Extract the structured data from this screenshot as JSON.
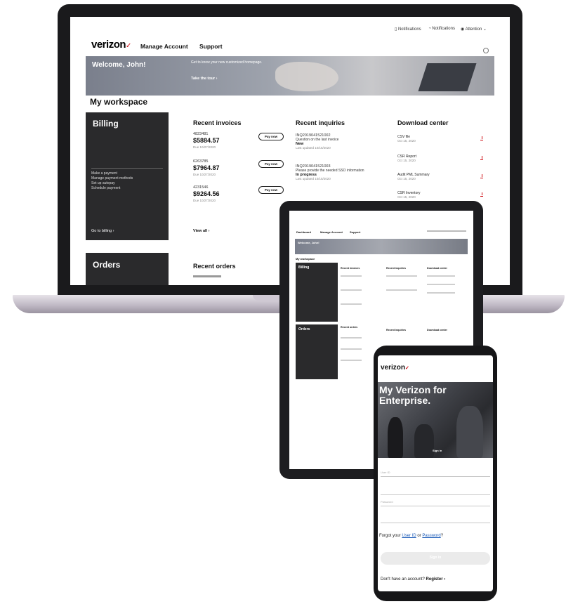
{
  "laptop": {
    "topbar": {
      "item1": "Notifications",
      "item2": "Notifications",
      "item3": "Attention"
    },
    "logo": "verizon",
    "nav": [
      "Manage Account",
      "Support"
    ],
    "hero": {
      "welcome": "Welcome, John!",
      "promo": "Get to know your new customized homepage.",
      "tour": "Take the tour ›"
    },
    "workspace_title": "My workspace",
    "billing": {
      "title": "Billing",
      "links": [
        "Make a payment",
        "Manage payment methods",
        "Set up autopay",
        "Schedule payment"
      ],
      "goto": "Go to billing ›"
    },
    "orders": {
      "title": "Orders"
    },
    "recent_invoices": {
      "title": "Recent invoices",
      "items": [
        {
          "id": "4823481",
          "amount": "$5884.57",
          "sub": "Due 10/27/2020",
          "action": "Pay now"
        },
        {
          "id": "6263785",
          "amount": "$7964.87",
          "sub": "Due 10/27/2020",
          "action": "Pay now"
        },
        {
          "id": "4231546",
          "amount": "$9264.56",
          "sub": "Due 10/27/2020",
          "action": "Pay now"
        }
      ],
      "view_all": "View all ›"
    },
    "recent_orders": {
      "title": "Recent orders"
    },
    "recent_inquiries": {
      "title": "Recent inquiries",
      "items": [
        {
          "id": "INQ2019041521002",
          "desc": "Question on the last invoice",
          "status": "New",
          "date": "Last updated 10/15/2020"
        },
        {
          "id": "INQ2019041521003",
          "desc": "Please provide the needed SSO information",
          "status": "In progress",
          "date": "Last updated 10/15/2020"
        }
      ]
    },
    "download_center": {
      "title": "Download center",
      "items": [
        {
          "name": "CSV file",
          "date": "Oct 15, 2020"
        },
        {
          "name": "CSR Report",
          "date": "Oct 15, 2020"
        },
        {
          "name": "Audit PML Summary",
          "date": "Oct 15, 2020"
        },
        {
          "name": "CSR Inventory",
          "date": "Oct 15, 2020"
        }
      ]
    }
  },
  "tablet": {
    "nav": [
      "Dashboard",
      "Manage Account",
      "Support"
    ],
    "welcome": "Welcome, John!",
    "workspace_title": "My workspace",
    "billing": "Billing",
    "orders": "Orders",
    "col_invoices": "Recent invoices",
    "col_inquiries": "Recent inquiries",
    "col_downloads": "Download center",
    "col_orders": "Recent orders"
  },
  "phone": {
    "logo": "verizon",
    "headline": "My Verizon for Enterprise.",
    "hero_caption": "Sign in",
    "user_id_placeholder": "User ID",
    "password_placeholder": "Password",
    "forgot_prefix": "Forgot your ",
    "forgot_user_id": "User ID",
    "forgot_or": " or ",
    "forgot_password": "Password",
    "forgot_suffix": "?",
    "sign_in": "Sign in",
    "register_prefix": "Don't have an account? ",
    "register_link": "Register ›"
  }
}
